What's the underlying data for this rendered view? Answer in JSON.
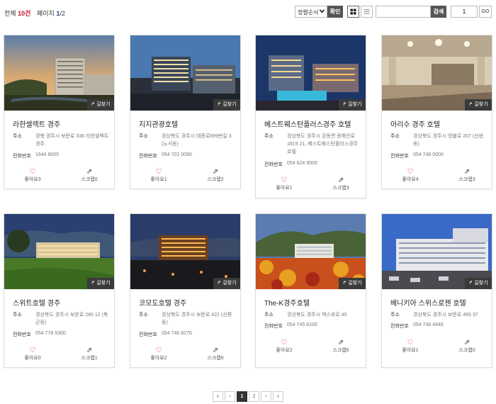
{
  "toolbar": {
    "total_label": "전체",
    "total_count": "10건",
    "page_label": "페이지",
    "page_current": "1",
    "page_total": "/2",
    "sort_value": "정렬순서",
    "confirm_label": "확인",
    "search_placeholder": "",
    "search_label": "검색",
    "page_input_value": "1",
    "go_label": "GO"
  },
  "cards": [
    {
      "name": "라한셀렉트 경주",
      "addr_label": "주소",
      "addr": "경북 경주시 보문로 338 라한셀렉트 경주",
      "tel_label": "전화번호",
      "tel": "1644 8005",
      "like": "좋아요3",
      "scrap": "스크랩0",
      "find": "길찾기"
    },
    {
      "name": "지지관광호텔",
      "addr_label": "주소",
      "addr": "경상북도 경주시 태종로699번길 3 (노서동)",
      "tel_label": "전화번호",
      "tel": "054 701 0095",
      "like": "좋아요1",
      "scrap": "스크랩2",
      "find": "길찾기"
    },
    {
      "name": "베스트웨스턴플러스경주 호텔",
      "addr_label": "주소",
      "addr": "경상북도 경주시 강동면 동해안로 1819 21, 베스트웨스턴플러스경주호텔",
      "tel_label": "전화번호",
      "tel": "054 624 9000",
      "like": "좋아요1",
      "scrap": "스크랩3",
      "find": "길찾기"
    },
    {
      "name": "아리수 경주 호텔",
      "addr_label": "주소",
      "addr": "경상북도 경주시 영불로 207 (신현동)",
      "tel_label": "전화번호",
      "tel": "054 746 0000",
      "like": "좋아요4",
      "scrap": "스크랩3",
      "find": "길찾기"
    },
    {
      "name": "스위트호텔 경주",
      "addr_label": "주소",
      "addr": "경상북도 경주시 보문로 280 12 (북군동)",
      "tel_label": "전화번호",
      "tel": "054 778 5300",
      "like": "좋아요0",
      "scrap": "스크랩1",
      "find": "길찾기"
    },
    {
      "name": "코모도호텔 경주",
      "addr_label": "주소",
      "addr": "경상북도 경주시 보문로 422 (신평동)",
      "tel_label": "전화번호",
      "tel": "054 740 8276",
      "like": "좋아요2",
      "scrap": "스크랩6",
      "find": "길찾기"
    },
    {
      "name": "The-K경주호텔",
      "addr_label": "주소",
      "addr": "경상북도 경주시 엑스포로 45",
      "tel_label": "전화번호",
      "tel": "054 745 8100",
      "like": "좋아요2",
      "scrap": "스크랩6",
      "find": "길찾기"
    },
    {
      "name": "베니키아 스위스로젠 호텔",
      "addr_label": "주소",
      "addr": "경상북도 경주시 보문로 465 37",
      "tel_label": "전화번호",
      "tel": "054 748 4848",
      "like": "좋아요1",
      "scrap": "스크랩0",
      "find": "길찾기"
    }
  ],
  "pagination": {
    "first": "«",
    "prev": "‹",
    "pages": [
      "1",
      "2"
    ],
    "next": "›",
    "last": "»"
  },
  "icons": {
    "like": "heart-icon",
    "scrap": "share-icon",
    "find": "directions-icon",
    "view_grid": "grid-view-icon",
    "view_list": "list-view-icon"
  }
}
